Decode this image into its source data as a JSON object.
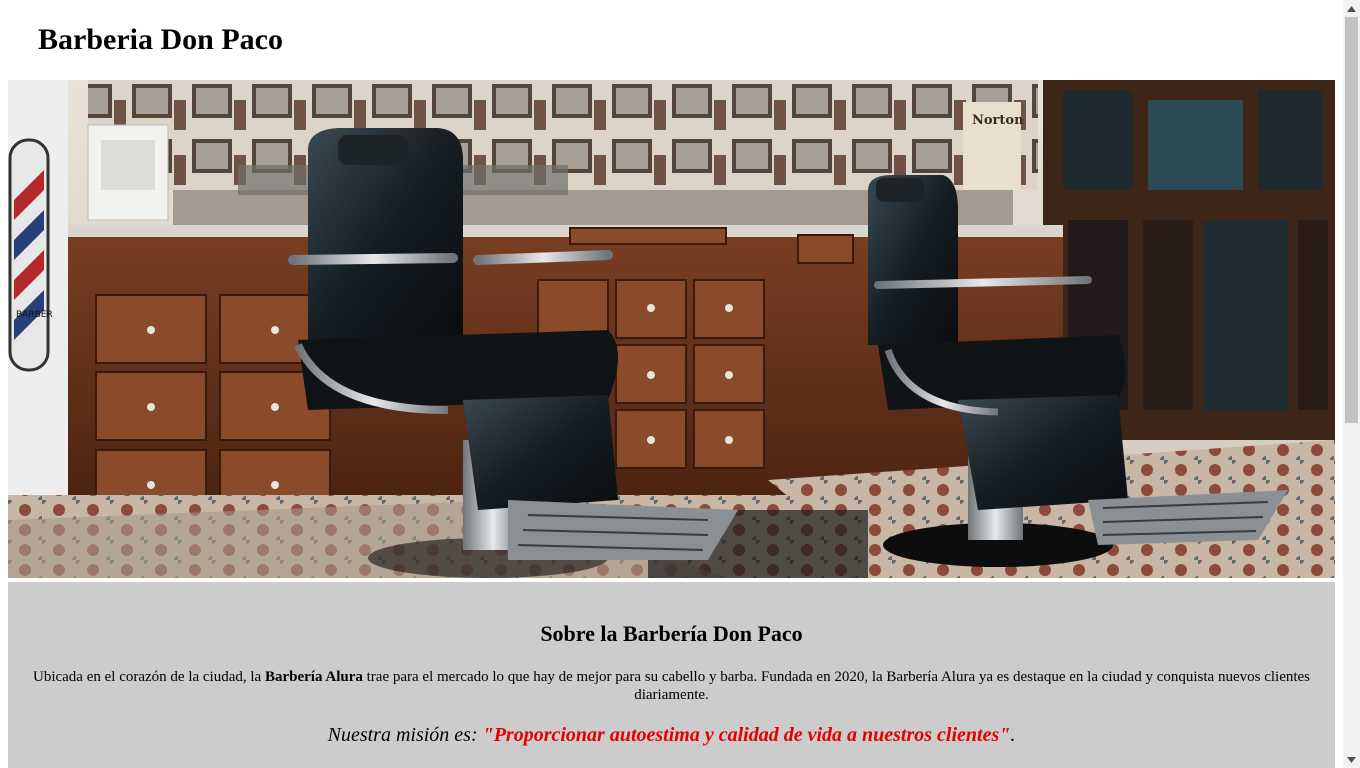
{
  "header": {
    "title": "Barberia Don Paco"
  },
  "hero": {
    "image_description": "barbershop-interior-photo",
    "pole_sign_text": "BARBER",
    "poster_text": "Norton"
  },
  "about": {
    "heading": "Sobre la Barbería Don Paco",
    "desc_before": "Ubicada en el corazón de la ciudad, la ",
    "desc_bold": "Barbería Alura",
    "desc_after": " trae para el mercado lo que hay de mejor para su cabello y barba. Fundada en 2020, la Barbería Alura ya es destaque en la ciudad y conquista nuevos clientes diariamente.",
    "mission_label": "Nuestra misión es: ",
    "mission_quote": "\"Proporcionar autoestima y calidad de vida a nuestros clientes\"",
    "mission_end": "."
  },
  "colors": {
    "about_bg": "#cccccc",
    "mission_quote": "#e40000"
  },
  "scrollbar": {
    "up_icon": "triangle-up-icon",
    "down_icon": "triangle-down-icon"
  }
}
